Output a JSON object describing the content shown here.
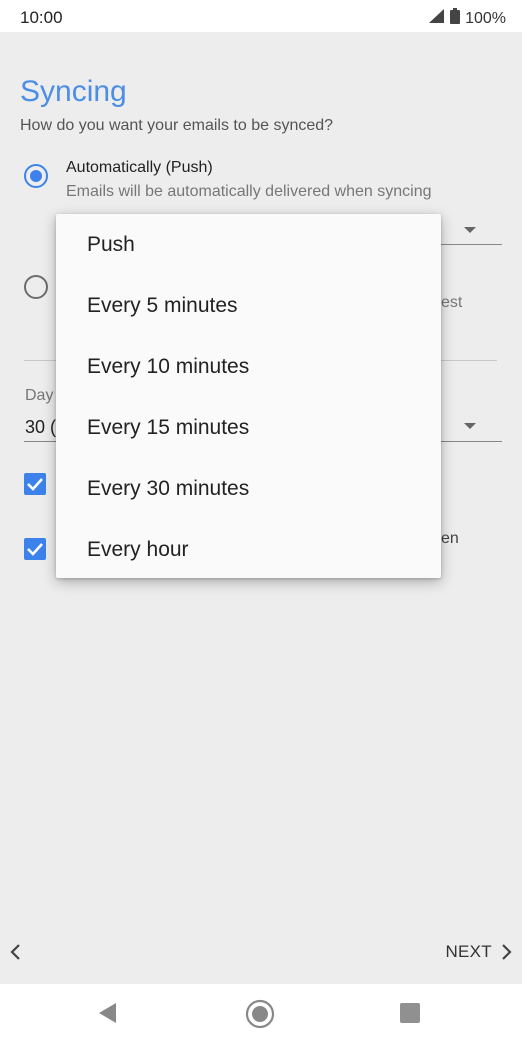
{
  "status_bar": {
    "time": "10:00",
    "battery": "100%"
  },
  "page": {
    "title": "Syncing",
    "subtitle": "How do you want your emails to be synced?"
  },
  "options": {
    "auto_title": "Automatically (Push)",
    "auto_desc": "Emails will be automatically delivered when syncing",
    "manual_fragment": "est"
  },
  "fields": {
    "days_label_fragment": "Day",
    "days_value_fragment": "30 (",
    "checkbox2_fragment": "en"
  },
  "menu": {
    "items": [
      "Push",
      "Every 5 minutes",
      "Every 10 minutes",
      "Every 15 minutes",
      "Every 30 minutes",
      "Every hour"
    ]
  },
  "navigation": {
    "next_label": "NEXT"
  },
  "colors": {
    "accent": "#3d82ea",
    "title": "#4c8ee6"
  }
}
